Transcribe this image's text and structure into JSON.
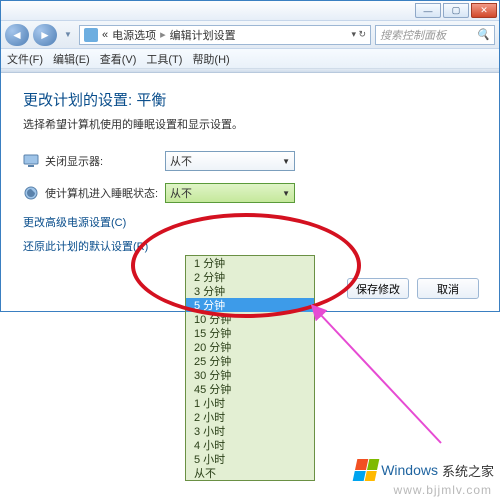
{
  "window": {
    "min": "—",
    "max": "▢",
    "close": "✕"
  },
  "nav": {
    "back": "◄",
    "fwd": "►",
    "crumb1": "电源选项",
    "crumb2": "编辑计划设置",
    "sep": "▸",
    "search_placeholder": "搜索控制面板"
  },
  "menu": {
    "file": "文件(F)",
    "edit": "编辑(E)",
    "view": "查看(V)",
    "tools": "工具(T)",
    "help": "帮助(H)"
  },
  "page": {
    "title": "更改计划的设置: 平衡",
    "subtitle": "选择希望计算机使用的睡眠设置和显示设置。",
    "row1_label": "关闭显示器:",
    "row1_value": "从不",
    "row2_label": "使计算机进入睡眠状态:",
    "row2_value": "从不",
    "link1": "更改高级电源设置(C)",
    "link2": "还原此计划的默认设置(R)",
    "save": "保存修改",
    "cancel": "取消"
  },
  "options": [
    "1 分钟",
    "2 分钟",
    "3 分钟",
    "5 分钟",
    "10 分钟",
    "15 分钟",
    "20 分钟",
    "25 分钟",
    "30 分钟",
    "45 分钟",
    "1 小时",
    "2 小时",
    "3 小时",
    "4 小时",
    "5 小时",
    "从不"
  ],
  "selected_option_index": 3,
  "watermark": {
    "brand": "Windows",
    "brand_suffix": "系统之家",
    "url": "www.bjjmlv.com"
  }
}
